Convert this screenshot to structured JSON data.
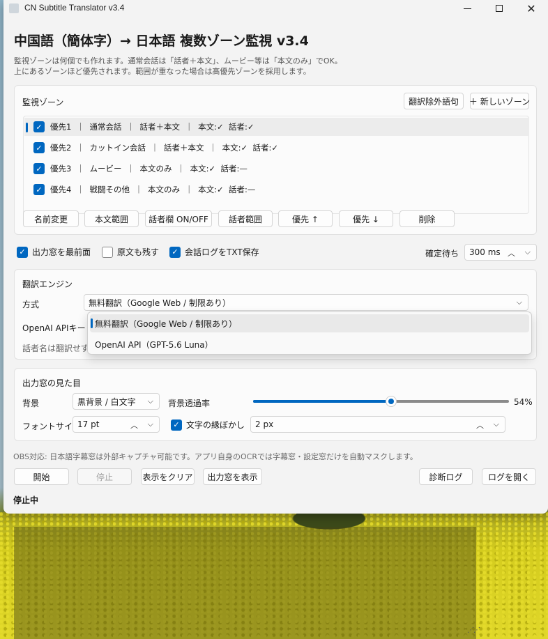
{
  "window": {
    "title": "CN Subtitle Translator v3.4",
    "minimize_glyph": "—",
    "close_glyph": "✕"
  },
  "header": {
    "title": "中国語（簡体字）→ 日本語  複数ゾーン監視  v3.4",
    "desc_line1": "監視ゾーンは何個でも作れます。通常会話は「話者＋本文」、ムービー等は「本文のみ」でOK。",
    "desc_line2": "上にあるゾーンほど優先されます。範囲が重なった場合は高優先ゾーンを採用します。"
  },
  "zones": {
    "label": "監視ゾーン",
    "exclude_button": "翻訳除外語句",
    "new_zone_button": "＋ 新しいゾーン",
    "items": [
      {
        "checked": true,
        "text": "優先1  ｜  通常会話  ｜  話者＋本文  ｜  本文:✓  話者:✓",
        "selected": true
      },
      {
        "checked": true,
        "text": "優先2  ｜  カットイン会話  ｜  話者＋本文  ｜  本文:✓  話者:✓",
        "selected": false
      },
      {
        "checked": true,
        "text": "優先3  ｜  ムービー  ｜  本文のみ  ｜  本文:✓  話者:—",
        "selected": false
      },
      {
        "checked": true,
        "text": "優先4  ｜  戦闘その他  ｜  本文のみ  ｜  本文:✓  話者:—",
        "selected": false
      }
    ],
    "actions": [
      "名前変更",
      "本文範囲",
      "話者欄 ON/OFF",
      "話者範囲",
      "優先 ↑",
      "優先 ↓",
      "削除"
    ]
  },
  "options": {
    "topmost_label": "出力窓を最前面",
    "topmost_checked": true,
    "keep_original_label": "原文も残す",
    "keep_original_checked": false,
    "save_log_label": "会話ログをTXT保存",
    "save_log_checked": true,
    "confirm_wait_label": "確定待ち",
    "confirm_wait_value": "300 ms"
  },
  "engine": {
    "label": "翻訳エンジン",
    "method_label": "方式",
    "method_value": "無料翻訳（Google Web / 制限あり）",
    "api_key_label": "OpenAI APIキー",
    "speaker_note": "話者名は翻訳せず",
    "dropdown_options": [
      "無料翻訳（Google Web / 制限あり）",
      "OpenAI API（GPT-5.6 Luna）"
    ],
    "dropdown_selected_index": 0
  },
  "appearance": {
    "label": "出力窓の見た目",
    "bg_label": "背景",
    "bg_value": "黒背景 / 白文字",
    "transparency_label": "背景透過率",
    "transparency_value": 54,
    "transparency_text": "54%",
    "font_size_label": "フォントサイズ",
    "font_size_value": "17 pt",
    "outline_label": "文字の縁ぼかし",
    "outline_checked": true,
    "outline_value": "2 px"
  },
  "footer": {
    "obs_note": "OBS対応: 日本語字幕窓は外部キャプチャ可能です。アプリ自身のOCRでは字幕窓・設定窓だけを自動マスクします。",
    "start_button": "開始",
    "stop_button": "停止",
    "clear_button": "表示をクリア",
    "show_output_button": "出力窓を表示",
    "diag_log_button": "診断ログ",
    "open_log_button": "ログを開く",
    "status": "停止中"
  },
  "colors": {
    "accent": "#0067c0",
    "window_bg": "#f3f3f3",
    "panel_bg": "#fbfbfb"
  },
  "icons": {
    "check": "✓",
    "chevron_down": "⌵",
    "chevron_up": "︿",
    "resize_grip": "⋰"
  }
}
